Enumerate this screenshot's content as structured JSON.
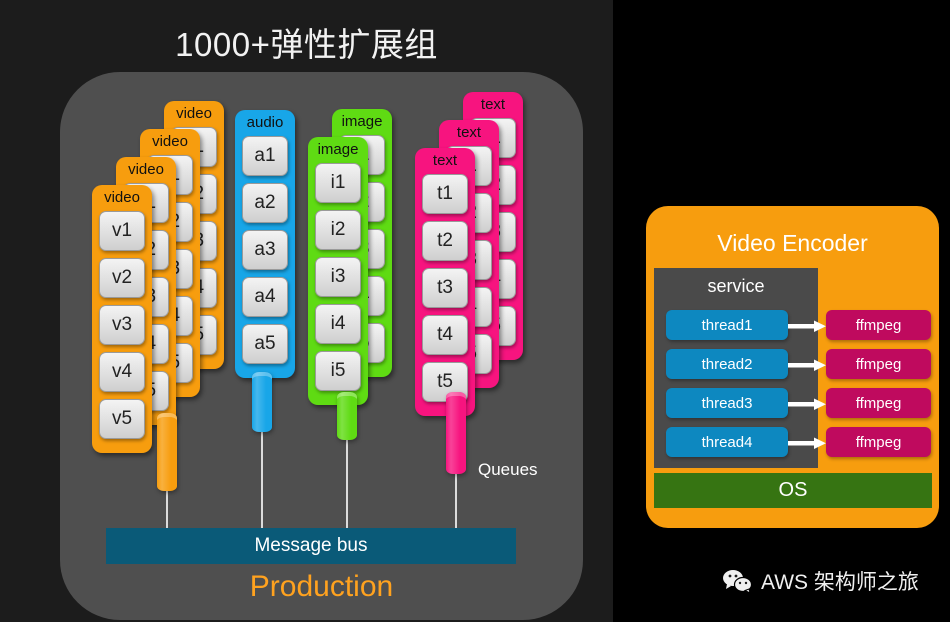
{
  "slide": {
    "title": "1000+弹性扩展组",
    "production_label": "Production",
    "queues_label": "Queues",
    "message_bus_label": "Message bus",
    "bg_color": "#1c1c1c",
    "panel_color": "#4f4f4f",
    "message_bus_color": "#0a5a78",
    "production_label_color": "#ffa21f"
  },
  "columns": [
    {
      "name": "video",
      "color": "#f79d0e",
      "stack_count": 4,
      "head_label": "video",
      "items": [
        "v1",
        "v2",
        "v3",
        "v4",
        "v5"
      ]
    },
    {
      "name": "audio",
      "color": "#18a6e8",
      "stack_count": 1,
      "head_label": "audio",
      "items": [
        "a1",
        "a2",
        "a3",
        "a4",
        "a5"
      ]
    },
    {
      "name": "image",
      "color": "#5fdb13",
      "stack_count": 2,
      "head_label": "image",
      "items": [
        "i1",
        "i2",
        "i3",
        "i4",
        "i5"
      ]
    },
    {
      "name": "text",
      "color": "#f7147f",
      "stack_count": 3,
      "head_label": "text",
      "items": [
        "t1",
        "t2",
        "t3",
        "t4",
        "t5"
      ]
    }
  ],
  "encoder": {
    "title": "Video Encoder",
    "panel_color": "#f79d0e",
    "service_label": "service",
    "service_color": "#4a4a4a",
    "thread_color": "#0d88c0",
    "ffmpeg_color": "#bf0a5e",
    "os_color": "#367412",
    "threads": [
      "thread1",
      "thread2",
      "thread3",
      "thread4"
    ],
    "workers": [
      "ffmpeg",
      "ffmpeg",
      "ffmpeg",
      "ffmpeg"
    ],
    "os_label": "OS"
  },
  "footer": {
    "wechat_label": "AWS 架构师之旅",
    "wechat_icon": "wechat-icon"
  }
}
